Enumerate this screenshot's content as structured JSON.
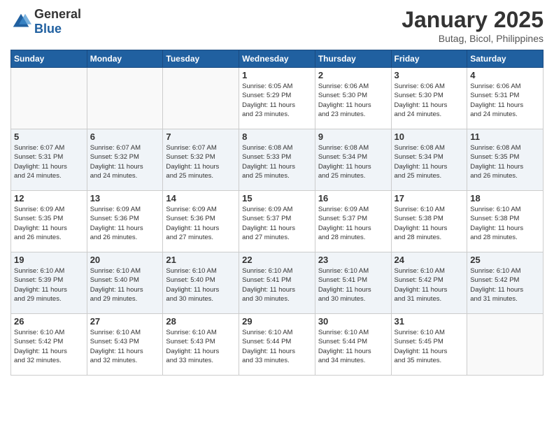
{
  "header": {
    "logo_general": "General",
    "logo_blue": "Blue",
    "main_title": "January 2025",
    "subtitle": "Butag, Bicol, Philippines"
  },
  "weekdays": [
    "Sunday",
    "Monday",
    "Tuesday",
    "Wednesday",
    "Thursday",
    "Friday",
    "Saturday"
  ],
  "weeks": [
    [
      {
        "day": "",
        "info": ""
      },
      {
        "day": "",
        "info": ""
      },
      {
        "day": "",
        "info": ""
      },
      {
        "day": "1",
        "info": "Sunrise: 6:05 AM\nSunset: 5:29 PM\nDaylight: 11 hours\nand 23 minutes."
      },
      {
        "day": "2",
        "info": "Sunrise: 6:06 AM\nSunset: 5:30 PM\nDaylight: 11 hours\nand 23 minutes."
      },
      {
        "day": "3",
        "info": "Sunrise: 6:06 AM\nSunset: 5:30 PM\nDaylight: 11 hours\nand 24 minutes."
      },
      {
        "day": "4",
        "info": "Sunrise: 6:06 AM\nSunset: 5:31 PM\nDaylight: 11 hours\nand 24 minutes."
      }
    ],
    [
      {
        "day": "5",
        "info": "Sunrise: 6:07 AM\nSunset: 5:31 PM\nDaylight: 11 hours\nand 24 minutes."
      },
      {
        "day": "6",
        "info": "Sunrise: 6:07 AM\nSunset: 5:32 PM\nDaylight: 11 hours\nand 24 minutes."
      },
      {
        "day": "7",
        "info": "Sunrise: 6:07 AM\nSunset: 5:32 PM\nDaylight: 11 hours\nand 25 minutes."
      },
      {
        "day": "8",
        "info": "Sunrise: 6:08 AM\nSunset: 5:33 PM\nDaylight: 11 hours\nand 25 minutes."
      },
      {
        "day": "9",
        "info": "Sunrise: 6:08 AM\nSunset: 5:34 PM\nDaylight: 11 hours\nand 25 minutes."
      },
      {
        "day": "10",
        "info": "Sunrise: 6:08 AM\nSunset: 5:34 PM\nDaylight: 11 hours\nand 25 minutes."
      },
      {
        "day": "11",
        "info": "Sunrise: 6:08 AM\nSunset: 5:35 PM\nDaylight: 11 hours\nand 26 minutes."
      }
    ],
    [
      {
        "day": "12",
        "info": "Sunrise: 6:09 AM\nSunset: 5:35 PM\nDaylight: 11 hours\nand 26 minutes."
      },
      {
        "day": "13",
        "info": "Sunrise: 6:09 AM\nSunset: 5:36 PM\nDaylight: 11 hours\nand 26 minutes."
      },
      {
        "day": "14",
        "info": "Sunrise: 6:09 AM\nSunset: 5:36 PM\nDaylight: 11 hours\nand 27 minutes."
      },
      {
        "day": "15",
        "info": "Sunrise: 6:09 AM\nSunset: 5:37 PM\nDaylight: 11 hours\nand 27 minutes."
      },
      {
        "day": "16",
        "info": "Sunrise: 6:09 AM\nSunset: 5:37 PM\nDaylight: 11 hours\nand 28 minutes."
      },
      {
        "day": "17",
        "info": "Sunrise: 6:10 AM\nSunset: 5:38 PM\nDaylight: 11 hours\nand 28 minutes."
      },
      {
        "day": "18",
        "info": "Sunrise: 6:10 AM\nSunset: 5:38 PM\nDaylight: 11 hours\nand 28 minutes."
      }
    ],
    [
      {
        "day": "19",
        "info": "Sunrise: 6:10 AM\nSunset: 5:39 PM\nDaylight: 11 hours\nand 29 minutes."
      },
      {
        "day": "20",
        "info": "Sunrise: 6:10 AM\nSunset: 5:40 PM\nDaylight: 11 hours\nand 29 minutes."
      },
      {
        "day": "21",
        "info": "Sunrise: 6:10 AM\nSunset: 5:40 PM\nDaylight: 11 hours\nand 30 minutes."
      },
      {
        "day": "22",
        "info": "Sunrise: 6:10 AM\nSunset: 5:41 PM\nDaylight: 11 hours\nand 30 minutes."
      },
      {
        "day": "23",
        "info": "Sunrise: 6:10 AM\nSunset: 5:41 PM\nDaylight: 11 hours\nand 30 minutes."
      },
      {
        "day": "24",
        "info": "Sunrise: 6:10 AM\nSunset: 5:42 PM\nDaylight: 11 hours\nand 31 minutes."
      },
      {
        "day": "25",
        "info": "Sunrise: 6:10 AM\nSunset: 5:42 PM\nDaylight: 11 hours\nand 31 minutes."
      }
    ],
    [
      {
        "day": "26",
        "info": "Sunrise: 6:10 AM\nSunset: 5:42 PM\nDaylight: 11 hours\nand 32 minutes."
      },
      {
        "day": "27",
        "info": "Sunrise: 6:10 AM\nSunset: 5:43 PM\nDaylight: 11 hours\nand 32 minutes."
      },
      {
        "day": "28",
        "info": "Sunrise: 6:10 AM\nSunset: 5:43 PM\nDaylight: 11 hours\nand 33 minutes."
      },
      {
        "day": "29",
        "info": "Sunrise: 6:10 AM\nSunset: 5:44 PM\nDaylight: 11 hours\nand 33 minutes."
      },
      {
        "day": "30",
        "info": "Sunrise: 6:10 AM\nSunset: 5:44 PM\nDaylight: 11 hours\nand 34 minutes."
      },
      {
        "day": "31",
        "info": "Sunrise: 6:10 AM\nSunset: 5:45 PM\nDaylight: 11 hours\nand 35 minutes."
      },
      {
        "day": "",
        "info": ""
      }
    ]
  ]
}
